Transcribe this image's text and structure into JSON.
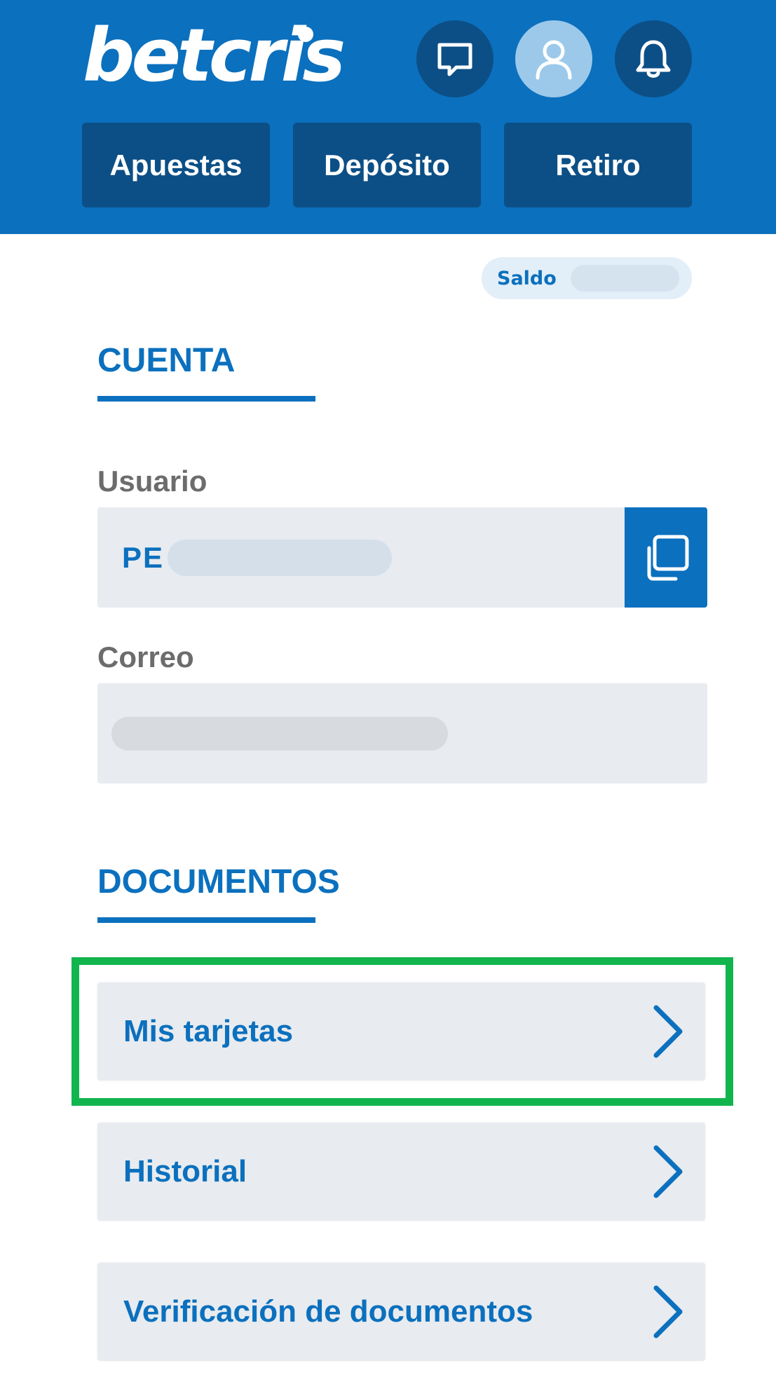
{
  "header": {
    "logo_text": "betcris",
    "icons": [
      "chat-icon",
      "user-icon",
      "bell-icon"
    ],
    "nav": [
      "Apuestas",
      "Depósito",
      "Retiro"
    ]
  },
  "balance": {
    "label": "Saldo"
  },
  "account": {
    "title": "CUENTA",
    "user_label": "Usuario",
    "user_value": "PE",
    "email_label": "Correo"
  },
  "documents": {
    "title": "DOCUMENTOS",
    "items": [
      "Mis tarjetas",
      "Historial",
      "Verificación de documentos"
    ]
  },
  "colors": {
    "header_bg": "#0b70be",
    "button_bg": "#0c4f86",
    "accent": "#0b70be",
    "highlight": "#12b54d",
    "field_bg": "#e8ebef"
  }
}
